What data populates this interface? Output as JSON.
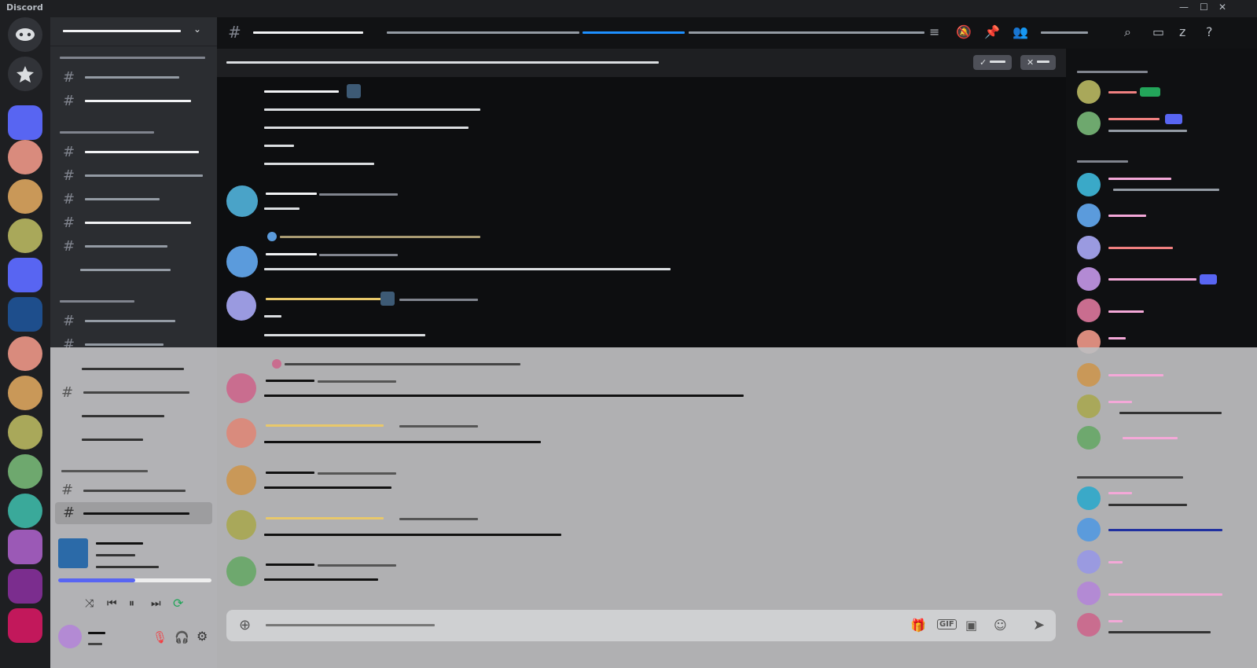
{
  "window": {
    "title": "Discord"
  },
  "window_controls": {
    "minimize": "—",
    "maximize": "☐",
    "close": "✕"
  },
  "composer": {
    "gif_label": "GIF"
  },
  "colors": {
    "accent": "#5865f2",
    "online": "#23a55a",
    "dnd": "#f23f43",
    "idle": "#f0b232",
    "progress": "#1e90ff"
  },
  "icons": [
    "discord-home-icon",
    "star-icon",
    "hash-icon",
    "threads-icon",
    "mute-icon",
    "pin-icon",
    "members-icon",
    "search-icon",
    "inbox-icon",
    "help-icon",
    "gift-icon",
    "sticker-icon",
    "emoji-icon",
    "send-icon",
    "shuffle-icon",
    "previous-icon",
    "pause-icon",
    "next-icon",
    "repeat-icon",
    "mic-off-icon",
    "headphones-icon",
    "settings-icon",
    "add-icon",
    "check-icon",
    "close-icon"
  ],
  "player": {
    "progress": 0.5
  }
}
